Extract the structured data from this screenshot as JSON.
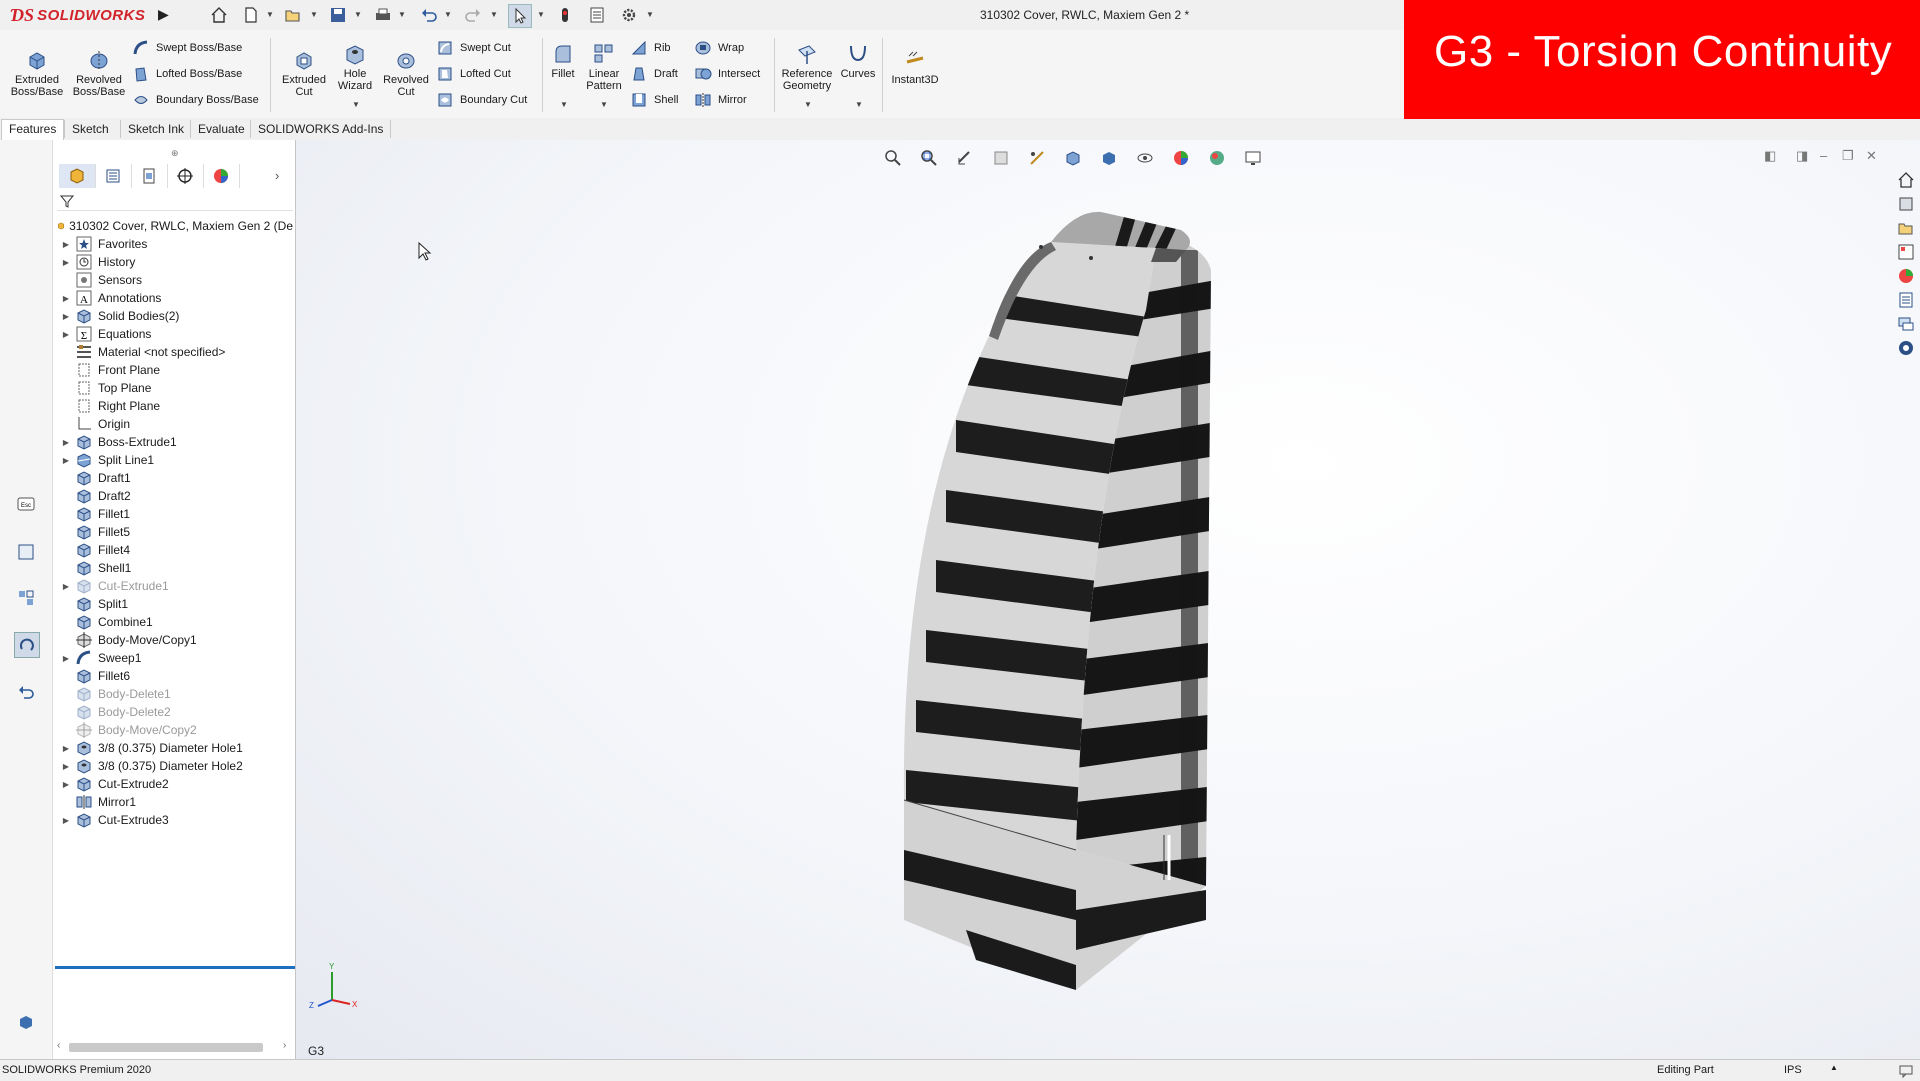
{
  "app": {
    "logo_text": "SOLIDWORKS",
    "document_title": "310302 Cover, RWLC, Maxiem Gen 2 *"
  },
  "overlay": {
    "text": "G3 - Torsion Continuity",
    "color": "#ff0000"
  },
  "quick_access": [
    {
      "name": "home-icon"
    },
    {
      "name": "new-document-icon"
    },
    {
      "name": "open-icon"
    },
    {
      "name": "save-icon"
    },
    {
      "name": "print-icon"
    },
    {
      "name": "undo-icon"
    },
    {
      "name": "redo-icon"
    },
    {
      "name": "select-icon"
    },
    {
      "name": "rebuild-icon"
    },
    {
      "name": "file-properties-icon"
    },
    {
      "name": "options-icon"
    }
  ],
  "ribbon": {
    "large_buttons": [
      {
        "label": "Extruded Boss/Base",
        "icon": "extruded-boss-icon"
      },
      {
        "label": "Revolved Boss/Base",
        "icon": "revolved-boss-icon"
      },
      {
        "label": "Extruded Cut",
        "icon": "extruded-cut-icon"
      },
      {
        "label": "Hole Wizard",
        "icon": "hole-wizard-icon"
      },
      {
        "label": "Revolved Cut",
        "icon": "revolved-cut-icon"
      },
      {
        "label": "Fillet",
        "icon": "fillet-icon"
      },
      {
        "label": "Linear Pattern",
        "icon": "linear-pattern-icon"
      },
      {
        "label": "Reference Geometry",
        "icon": "reference-geometry-icon"
      },
      {
        "label": "Curves",
        "icon": "curves-icon"
      },
      {
        "label": "Instant3D",
        "icon": "instant3d-icon"
      }
    ],
    "small_buttons": [
      {
        "label": "Swept Boss/Base",
        "icon": "swept-boss-icon"
      },
      {
        "label": "Lofted Boss/Base",
        "icon": "lofted-boss-icon"
      },
      {
        "label": "Boundary Boss/Base",
        "icon": "boundary-boss-icon"
      },
      {
        "label": "Swept Cut",
        "icon": "swept-cut-icon"
      },
      {
        "label": "Lofted Cut",
        "icon": "lofted-cut-icon"
      },
      {
        "label": "Boundary Cut",
        "icon": "boundary-cut-icon"
      },
      {
        "label": "Rib",
        "icon": "rib-icon"
      },
      {
        "label": "Draft",
        "icon": "draft-icon"
      },
      {
        "label": "Shell",
        "icon": "shell-icon"
      },
      {
        "label": "Wrap",
        "icon": "wrap-icon"
      },
      {
        "label": "Intersect",
        "icon": "intersect-icon"
      },
      {
        "label": "Mirror",
        "icon": "mirror-icon"
      }
    ]
  },
  "tabs": [
    "Features",
    "Sketch",
    "Sketch Ink",
    "Evaluate",
    "SOLIDWORKS Add-Ins"
  ],
  "feature_manager": {
    "root_label": "310302 Cover, RWLC, Maxiem Gen 2  (De",
    "nodes": [
      {
        "label": "Favorites",
        "icon": "favorites-icon",
        "expandable": true,
        "suppressed": false
      },
      {
        "label": "History",
        "icon": "history-icon",
        "expandable": true,
        "suppressed": false
      },
      {
        "label": "Sensors",
        "icon": "sensors-icon",
        "expandable": false,
        "suppressed": false
      },
      {
        "label": "Annotations",
        "icon": "annotations-icon",
        "expandable": true,
        "suppressed": false
      },
      {
        "label": "Solid Bodies(2)",
        "icon": "solid-bodies-icon",
        "expandable": true,
        "suppressed": false
      },
      {
        "label": "Equations",
        "icon": "equations-icon",
        "expandable": true,
        "suppressed": false
      },
      {
        "label": "Material <not specified>",
        "icon": "material-icon",
        "expandable": false,
        "suppressed": false
      },
      {
        "label": "Front Plane",
        "icon": "plane-icon",
        "expandable": false,
        "suppressed": false
      },
      {
        "label": "Top Plane",
        "icon": "plane-icon",
        "expandable": false,
        "suppressed": false
      },
      {
        "label": "Right Plane",
        "icon": "plane-icon",
        "expandable": false,
        "suppressed": false
      },
      {
        "label": "Origin",
        "icon": "origin-icon",
        "expandable": false,
        "suppressed": false
      },
      {
        "label": "Boss-Extrude1",
        "icon": "extrude-feature-icon",
        "expandable": true,
        "suppressed": false
      },
      {
        "label": "Split Line1",
        "icon": "split-line-icon",
        "expandable": true,
        "suppressed": false
      },
      {
        "label": "Draft1",
        "icon": "draft-feature-icon",
        "expandable": false,
        "suppressed": false
      },
      {
        "label": "Draft2",
        "icon": "draft-feature-icon",
        "expandable": false,
        "suppressed": false
      },
      {
        "label": "Fillet1",
        "icon": "fillet-feature-icon",
        "expandable": false,
        "suppressed": false
      },
      {
        "label": "Fillet5",
        "icon": "fillet-feature-icon",
        "expandable": false,
        "suppressed": false
      },
      {
        "label": "Fillet4",
        "icon": "fillet-feature-icon",
        "expandable": false,
        "suppressed": false
      },
      {
        "label": "Shell1",
        "icon": "shell-feature-icon",
        "expandable": false,
        "suppressed": false
      },
      {
        "label": "Cut-Extrude1",
        "icon": "cut-extrude-icon",
        "expandable": true,
        "suppressed": true
      },
      {
        "label": "Split1",
        "icon": "split-feature-icon",
        "expandable": false,
        "suppressed": false
      },
      {
        "label": "Combine1",
        "icon": "combine-icon",
        "expandable": false,
        "suppressed": false
      },
      {
        "label": "Body-Move/Copy1",
        "icon": "move-copy-icon",
        "expandable": false,
        "suppressed": false
      },
      {
        "label": "Sweep1",
        "icon": "sweep-feature-icon",
        "expandable": true,
        "suppressed": false
      },
      {
        "label": "Fillet6",
        "icon": "fillet-feature-icon",
        "expandable": false,
        "suppressed": false
      },
      {
        "label": "Body-Delete1",
        "icon": "body-delete-icon",
        "expandable": false,
        "suppressed": true
      },
      {
        "label": "Body-Delete2",
        "icon": "body-delete-icon",
        "expandable": false,
        "suppressed": true
      },
      {
        "label": "Body-Move/Copy2",
        "icon": "move-copy-icon",
        "expandable": false,
        "suppressed": true
      },
      {
        "label": "3/8 (0.375) Diameter Hole1",
        "icon": "hole-feature-icon",
        "expandable": true,
        "suppressed": false
      },
      {
        "label": "3/8 (0.375) Diameter Hole2",
        "icon": "hole-feature-icon",
        "expandable": true,
        "suppressed": false
      },
      {
        "label": "Cut-Extrude2",
        "icon": "cut-extrude-icon",
        "expandable": true,
        "suppressed": false
      },
      {
        "label": "Mirror1",
        "icon": "mirror-feature-icon",
        "expandable": false,
        "suppressed": false
      },
      {
        "label": "Cut-Extrude3",
        "icon": "cut-extrude-icon",
        "expandable": true,
        "suppressed": false
      }
    ]
  },
  "graphics": {
    "sheet_label": "G3",
    "triad": {
      "x": "X",
      "y": "Y",
      "z": "Z"
    }
  },
  "status_bar": {
    "app_version": "SOLIDWORKS Premium 2020",
    "mode": "Editing Part",
    "units": "IPS"
  }
}
